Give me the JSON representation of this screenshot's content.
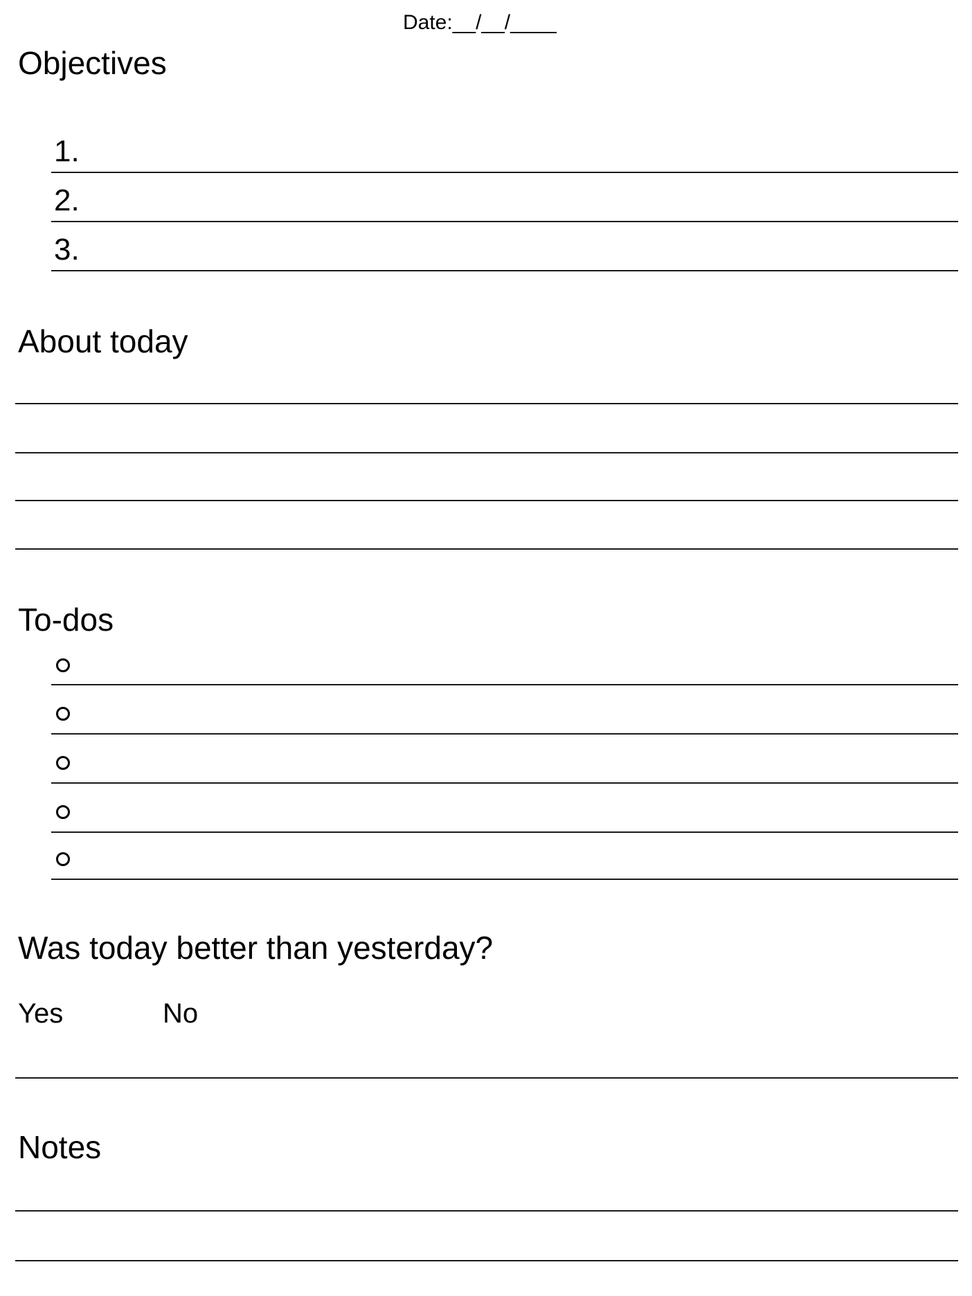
{
  "date": {
    "label": "Date:__/__/____"
  },
  "objectives": {
    "title": "Objectives",
    "items": [
      {
        "number": "1."
      },
      {
        "number": "2."
      },
      {
        "number": "3."
      }
    ]
  },
  "about_today": {
    "title": "About today"
  },
  "todos": {
    "title": "To-dos"
  },
  "question": {
    "title": "Was today better than yesterday?",
    "options": [
      "Yes",
      "No"
    ]
  },
  "notes": {
    "title": "Notes"
  }
}
